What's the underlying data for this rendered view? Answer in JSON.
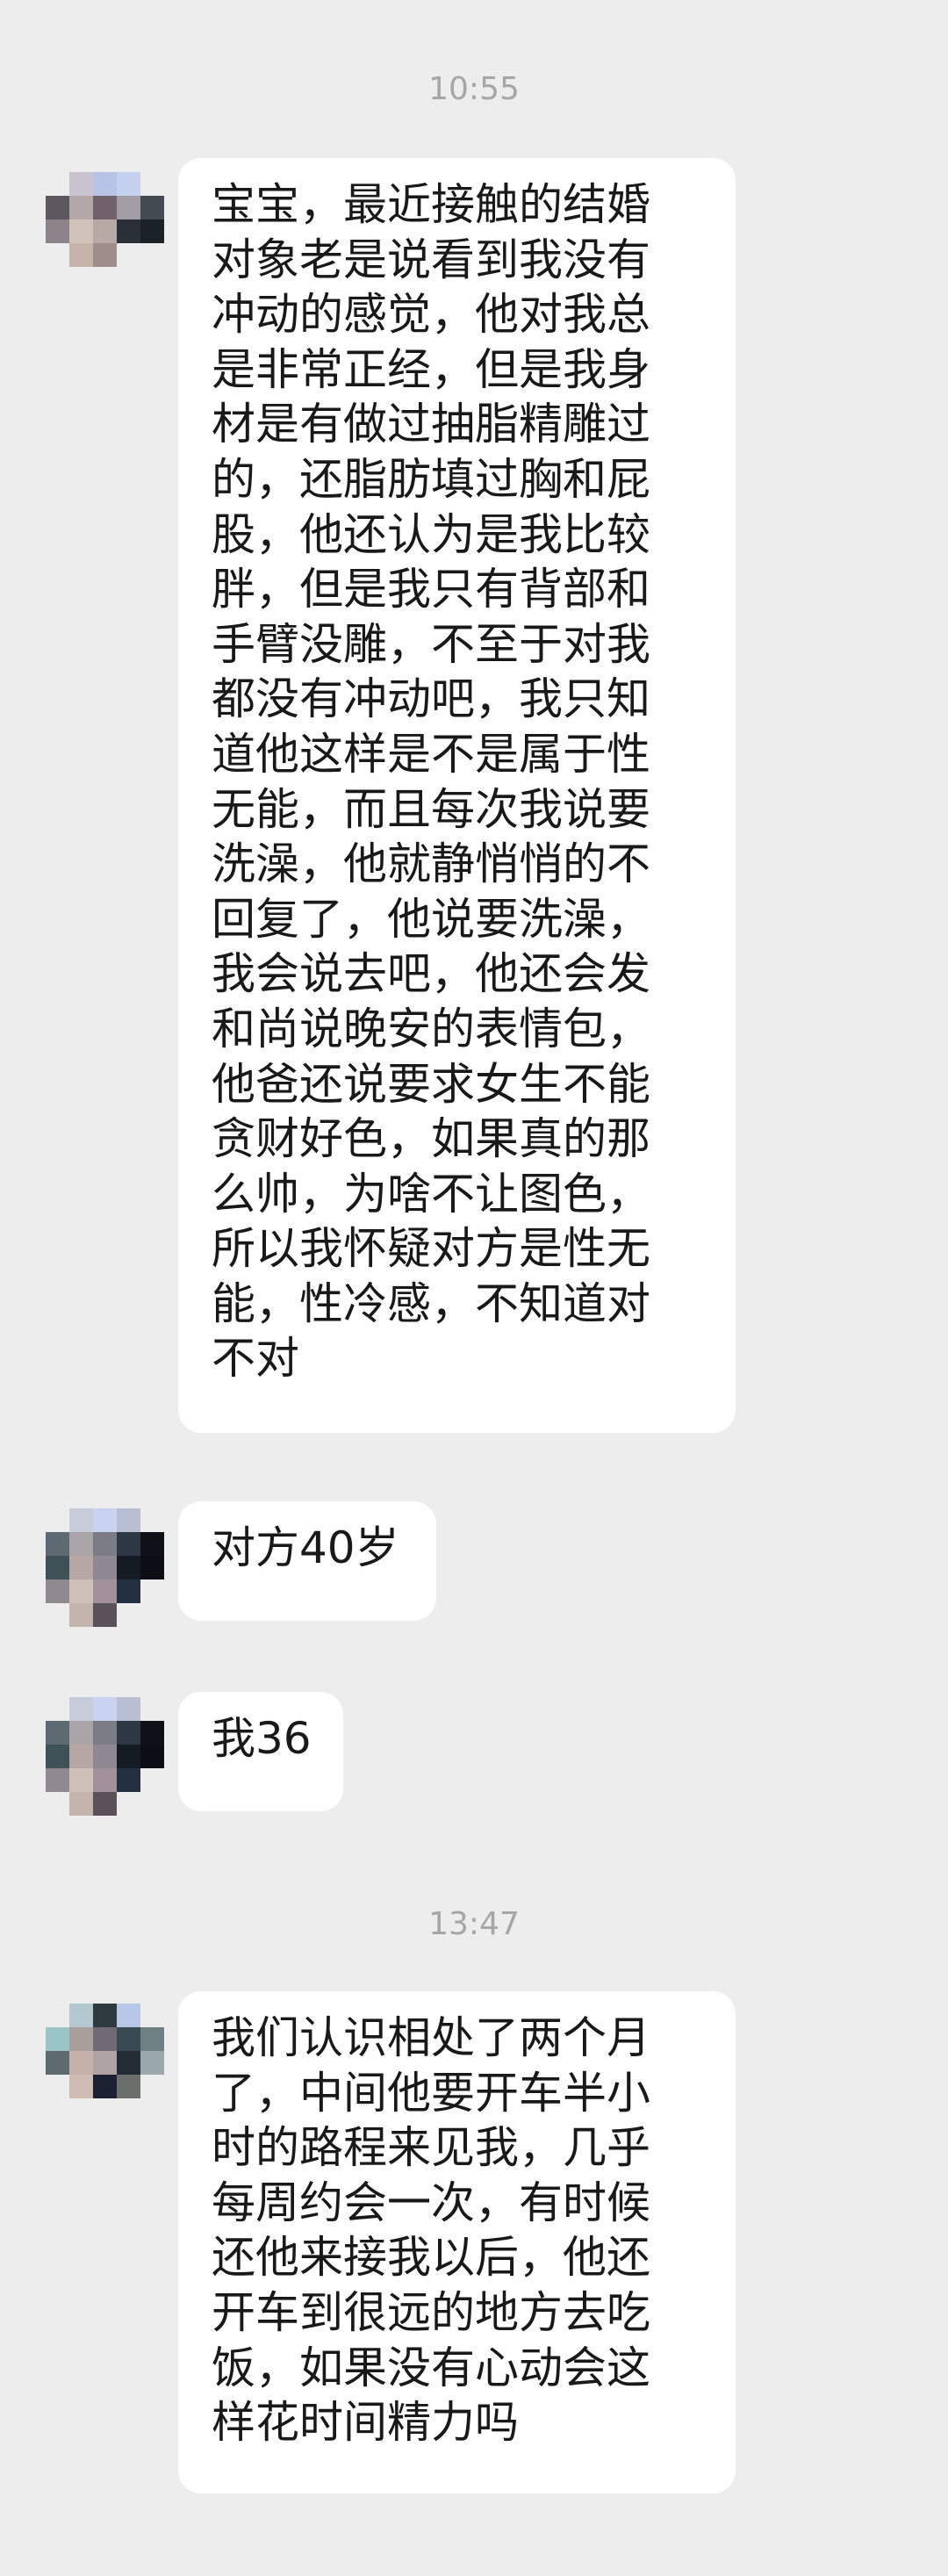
{
  "timestamps": [
    "10:55",
    "13:47"
  ],
  "messages": [
    {
      "lines": [
        "宝宝，最近接触的结婚",
        "对象老是说看到我没有",
        "冲动的感觉，他对我总",
        "是非常正经，但是我身",
        "材是有做过抽脂精雕过",
        "的，还脂肪填过胸和屁",
        "股，他还认为是我比较",
        "胖，但是我只有背部和",
        "手臂没雕，不至于对我",
        "都没有冲动吧，我只知",
        "道他这样是不是属于性",
        "无能，而且每次我说要",
        "洗澡，他就静悄悄的不",
        "回复了，他说要洗澡，",
        "我会说去吧，他还会发",
        "和尚说晚安的表情包，",
        "他爸还说要求女生不能",
        "贪财好色，如果真的那",
        "么帅，为啥不让图色，",
        "所以我怀疑对方是性无",
        "能，性冷感，不知道对",
        "不对"
      ]
    },
    {
      "lines": [
        "对方40岁"
      ]
    },
    {
      "lines": [
        "我36"
      ]
    },
    {
      "lines": [
        "我们认识相处了两个月",
        "了，中间他要开车半小",
        "时的路程来见我，几乎",
        "每周约会一次，有时候",
        "还他来接我以后，他还",
        "开车到很远的地方去吃",
        "饭，如果没有心动会这",
        "样花时间精力吗"
      ]
    }
  ],
  "colors": {
    "background": "#ededed",
    "bubble": "#ffffff",
    "text": "#191919",
    "timestamp": "#a6a6a6"
  },
  "icons": [
    "avatar-pixelated"
  ]
}
